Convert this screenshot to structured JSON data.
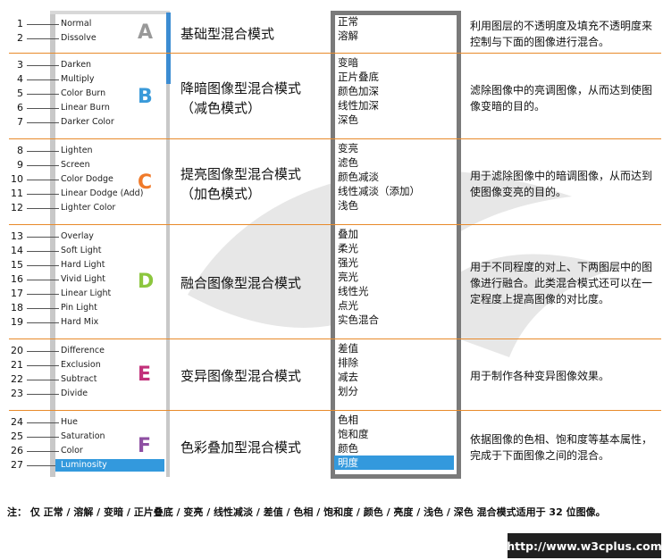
{
  "groups": [
    {
      "letter": "A",
      "color": "#999999",
      "title": "基础型混合模式",
      "title_sub": "",
      "items": [
        {
          "n": "1",
          "en": "Normal",
          "cn": "正常"
        },
        {
          "n": "2",
          "en": "Dissolve",
          "cn": "溶解"
        }
      ],
      "desc": "利用图层的不透明度及填充不透明度来控制与下面的图像进行混合。"
    },
    {
      "letter": "B",
      "color": "#3a9ad9",
      "title": "降暗图像型混合模式",
      "title_sub": "（减色模式）",
      "items": [
        {
          "n": "3",
          "en": "Darken",
          "cn": "变暗"
        },
        {
          "n": "4",
          "en": "Multiply",
          "cn": "正片叠底"
        },
        {
          "n": "5",
          "en": "Color Burn",
          "cn": "颜色加深"
        },
        {
          "n": "6",
          "en": "Linear Burn",
          "cn": "线性加深"
        },
        {
          "n": "7",
          "en": "Darker Color",
          "cn": "深色"
        }
      ],
      "desc": "滤除图像中的亮调图像，从而达到使图像变暗的目的。"
    },
    {
      "letter": "C",
      "color": "#f07a2a",
      "title": "提亮图像型混合模式",
      "title_sub": "（加色模式）",
      "items": [
        {
          "n": "8",
          "en": "Lighten",
          "cn": "变亮"
        },
        {
          "n": "9",
          "en": "Screen",
          "cn": "滤色"
        },
        {
          "n": "10",
          "en": "Color Dodge",
          "cn": "颜色减淡"
        },
        {
          "n": "11",
          "en": "Linear Dodge (Add)",
          "cn": "线性减淡（添加）"
        },
        {
          "n": "12",
          "en": "Lighter Color",
          "cn": "浅色"
        }
      ],
      "desc": "用于滤除图像中的暗调图像，从而达到使图像变亮的目的。"
    },
    {
      "letter": "D",
      "color": "#8cc63e",
      "title": "融合图像型混合模式",
      "title_sub": "",
      "items": [
        {
          "n": "13",
          "en": "Overlay",
          "cn": "叠加"
        },
        {
          "n": "14",
          "en": "Soft Light",
          "cn": "柔光"
        },
        {
          "n": "15",
          "en": "Hard Light",
          "cn": "强光"
        },
        {
          "n": "16",
          "en": "Vivid Light",
          "cn": "亮光"
        },
        {
          "n": "17",
          "en": "Linear Light",
          "cn": "线性光"
        },
        {
          "n": "18",
          "en": "Pin Light",
          "cn": "点光"
        },
        {
          "n": "19",
          "en": "Hard Mix",
          "cn": "实色混合"
        }
      ],
      "desc": "用于不同程度的对上、下两图层中的图像进行融合。此类混合模式还可以在一定程度上提高图像的对比度。"
    },
    {
      "letter": "E",
      "color": "#c2307a",
      "title": "变异图像型混合模式",
      "title_sub": "",
      "items": [
        {
          "n": "20",
          "en": "Difference",
          "cn": "差值"
        },
        {
          "n": "21",
          "en": "Exclusion",
          "cn": "排除"
        },
        {
          "n": "22",
          "en": "Subtract",
          "cn": "减去"
        },
        {
          "n": "23",
          "en": "Divide",
          "cn": "划分"
        }
      ],
      "desc": "用于制作各种变异图像效果。"
    },
    {
      "letter": "F",
      "color": "#8e4fa2",
      "title": "色彩叠加型混合模式",
      "title_sub": "",
      "items": [
        {
          "n": "24",
          "en": "Hue",
          "cn": "色相"
        },
        {
          "n": "25",
          "en": "Saturation",
          "cn": "饱和度"
        },
        {
          "n": "26",
          "en": "Color",
          "cn": "颜色"
        },
        {
          "n": "27",
          "en": "Luminosity",
          "cn": "明度",
          "selected": true
        }
      ],
      "desc": "依据图像的色相、饱和度等基本属性，完成于下面图像之间的混合。"
    }
  ],
  "note": "注： 仅 正常 / 溶解 / 变暗 / 正片叠底 / 变亮 / 线性减淡 / 差值 / 色相 / 饱和度 / 颜色 / 亮度 / 浅色 / 深色 混合模式适用于 32 位图像。",
  "url": "http://www.w3cplus.com"
}
